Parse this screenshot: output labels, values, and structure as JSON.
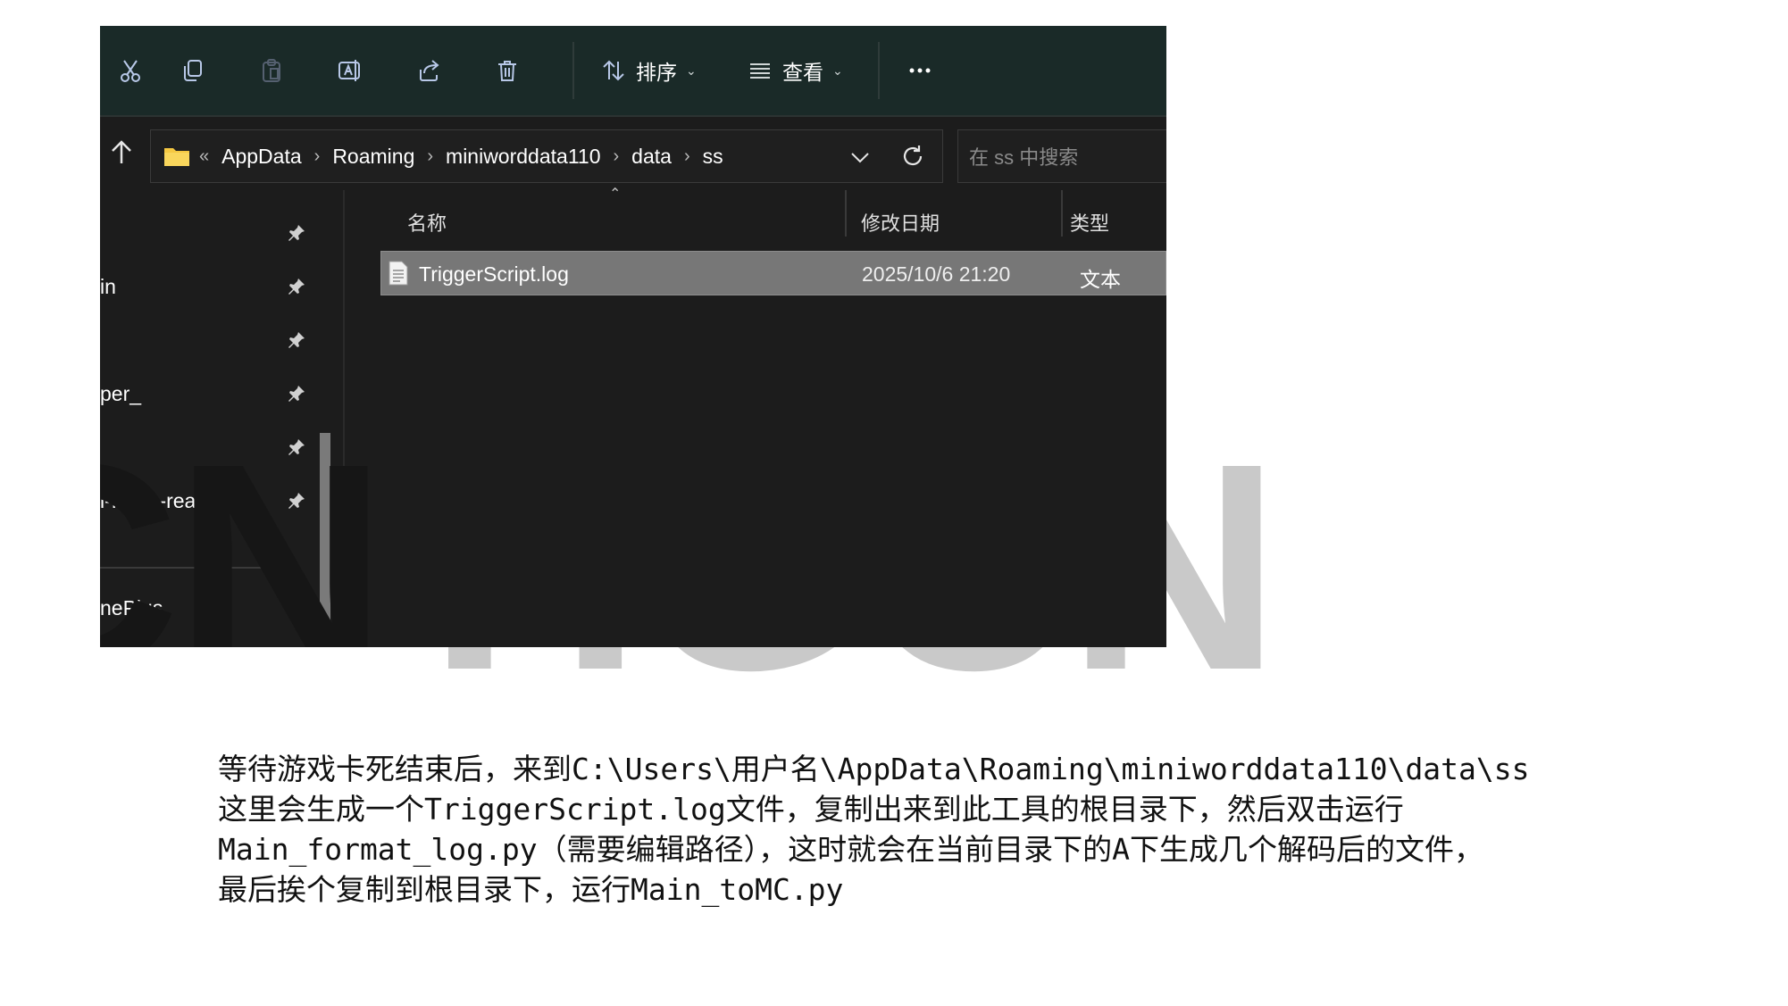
{
  "watermark": "HGCN",
  "toolbar": {
    "sort_label": "排序",
    "view_label": "查看",
    "icons": [
      "cut-icon",
      "copy-icon",
      "paste-icon",
      "rename-icon",
      "share-icon",
      "delete-icon",
      "sort-icon",
      "view-icon",
      "more-icon"
    ]
  },
  "address": {
    "overflow": "«",
    "crumbs": [
      "AppData",
      "Roaming",
      "miniworddata110",
      "data",
      "ss"
    ],
    "separator": "›",
    "search_placeholder": "在 ss 中搜索"
  },
  "sidebar": {
    "items": [
      {
        "label": ""
      },
      {
        "label": "in"
      },
      {
        "label": ""
      },
      {
        "label": "per_"
      },
      {
        "label": ""
      },
      {
        "label": "l-R-file-read-main"
      }
    ],
    "bottom_item": "nePlus"
  },
  "filelist": {
    "columns": [
      "名称",
      "修改日期",
      "类型"
    ],
    "rows": [
      {
        "name": "TriggerScript.log",
        "modified": "2025/10/6 21:20",
        "type": "文本"
      }
    ]
  },
  "caption": {
    "lines": [
      "等待游戏卡死结束后，来到C:\\Users\\用户名\\AppData\\Roaming\\miniworddata110\\data\\ss",
      "这里会生成一个TriggerScript.log文件，复制出来到此工具的根目录下，然后双击运行",
      "Main_format_log.py（需要编辑路径），这时就会在当前目录下的A下生成几个解码后的文件，",
      "最后挨个复制到根目录下，运行Main_toMC.py"
    ]
  },
  "colors": {
    "toolbar_bg": "#1a2a28",
    "window_bg": "#1c1c1c",
    "selected_row": "#777777",
    "folder_yellow": "#f5c842",
    "icon_blue": "#b8c8e8",
    "watermark": "#c9c9c9"
  }
}
